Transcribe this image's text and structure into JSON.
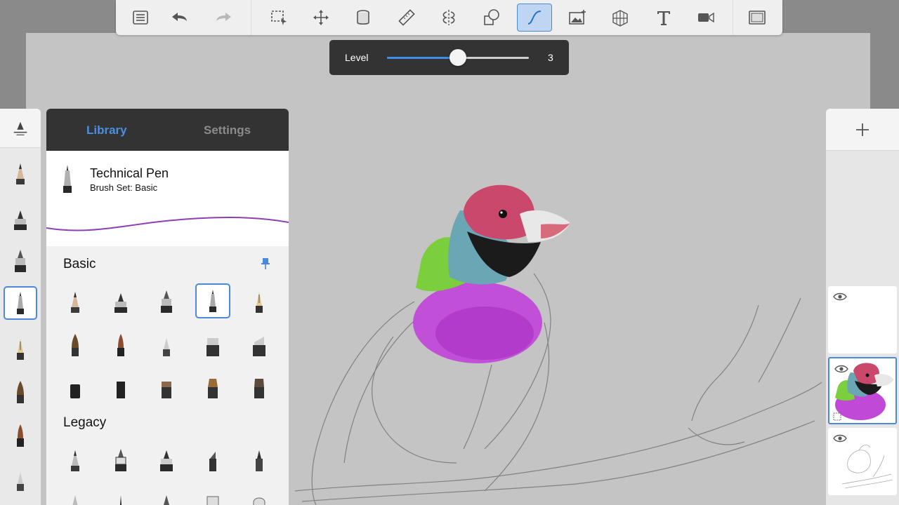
{
  "toolbar": {
    "buttons": [
      {
        "name": "brush-library-button",
        "icon": "list-icon"
      },
      {
        "name": "undo-button",
        "icon": "undo-icon"
      },
      {
        "name": "redo-button",
        "icon": "redo-icon",
        "disabled": true
      },
      {
        "name": "selection-button",
        "icon": "selection-icon"
      },
      {
        "name": "transform-button",
        "icon": "move-icon"
      },
      {
        "name": "fill-button",
        "icon": "paint-bucket-icon"
      },
      {
        "name": "ruler-button",
        "icon": "ruler-icon"
      },
      {
        "name": "symmetry-button",
        "icon": "symmetry-icon"
      },
      {
        "name": "shapes-button",
        "icon": "shapes-icon"
      },
      {
        "name": "predictive-stroke-button",
        "icon": "curve-icon",
        "active": true
      },
      {
        "name": "add-image-button",
        "icon": "image-icon"
      },
      {
        "name": "perspective-button",
        "icon": "perspective-grid-icon"
      },
      {
        "name": "text-button",
        "icon": "text-icon"
      },
      {
        "name": "timelapse-button",
        "icon": "video-camera-icon"
      },
      {
        "name": "fullscreen-button",
        "icon": "fullscreen-icon"
      }
    ]
  },
  "level_popup": {
    "label": "Level",
    "value": "3",
    "fraction": 0.5
  },
  "library": {
    "tabs": {
      "library": "Library",
      "settings": "Settings"
    },
    "current_brush": {
      "name": "Technical Pen",
      "set": "Brush Set: Basic"
    },
    "sections": {
      "basic": "Basic",
      "legacy": "Legacy"
    }
  },
  "layers": {
    "add_icon": "plus-icon",
    "selected_index": 1
  },
  "colors": {
    "accent": "#4a8ad8",
    "panel_dark": "#333333",
    "stroke_preview": "#8e3fb3",
    "canvas": "#c4c4c4"
  }
}
